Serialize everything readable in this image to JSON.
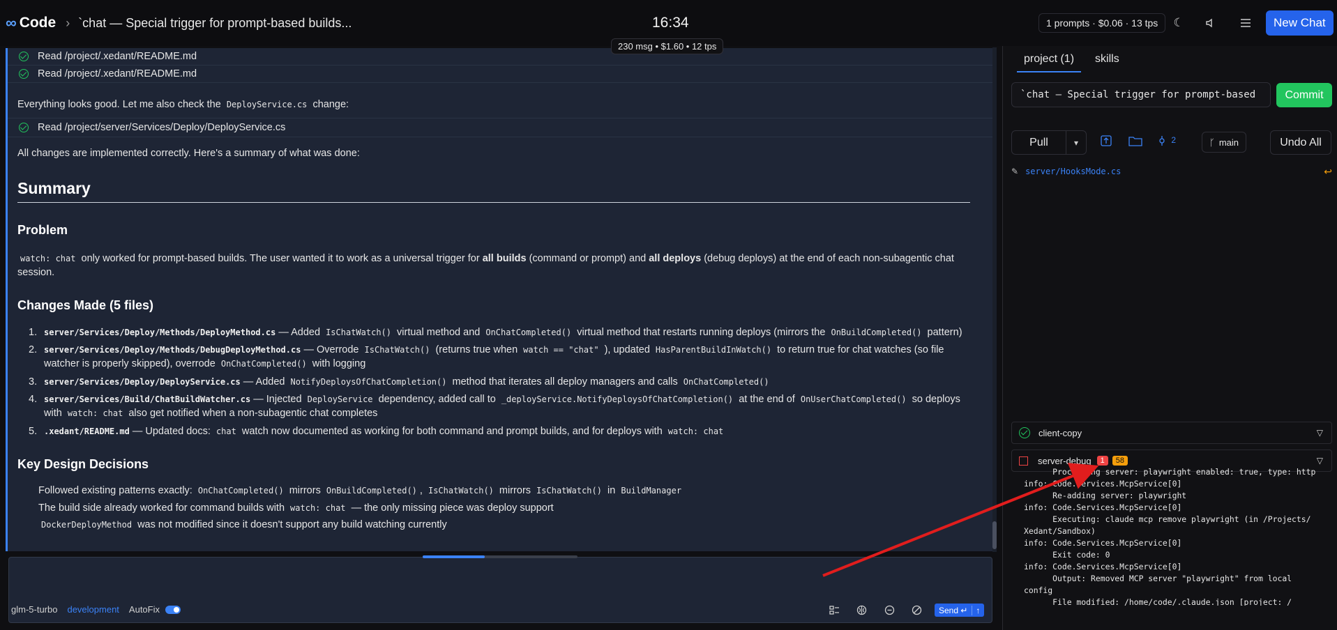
{
  "topbar": {
    "logo_symbol": "∞",
    "app_name": "Code",
    "separator": "›",
    "chat_title": "`chat — Special trigger for prompt-based builds...",
    "clock": "16:34",
    "stats": "1 prompts · $0.06 · 13 tps",
    "msg_stats": "230 msg • $1.60 • 12 tps",
    "new_chat_label": "New Chat"
  },
  "chat": {
    "read1": "Read /project/.xedant/README.md",
    "read2": "Read /project/.xedant/README.md",
    "check_pre": "Everything looks good. Let me also check the",
    "check_code": "DeployService.cs",
    "check_post": "change:",
    "read3": "Read /project/server/Services/Deploy/DeployService.cs",
    "all_changes": "All changes are implemented correctly. Here's a summary of what was done:",
    "summary_heading": "Summary",
    "problem_heading": "Problem",
    "problem_code": "watch: chat",
    "problem_t1": "only worked for prompt-based builds. The user wanted it to work as a universal trigger for",
    "problem_b1": "all builds",
    "problem_t2": "(command or prompt) and",
    "problem_b2": "all deploys",
    "problem_t3": "(debug deploys) at the end of each non-subagentic chat session.",
    "changes_heading": "Changes Made (5 files)",
    "items": [
      {
        "num": "1.",
        "file": "server/Services/Deploy/Methods/DeployMethod.cs",
        "t1": "— Added",
        "c1": "IsChatWatch()",
        "t2": "virtual method and",
        "c2": "OnChatCompleted()",
        "t3": "virtual method that restarts running deploys (mirrors the",
        "c3": "OnBuildCompleted()",
        "t4": "pattern)"
      },
      {
        "num": "2.",
        "file": "server/Services/Deploy/Methods/DebugDeployMethod.cs",
        "t1": "— Overrode",
        "c1": "IsChatWatch()",
        "t2": "(returns true when",
        "c2": "watch == \"chat\"",
        "t3": "), updated",
        "c3": "HasParentBuildInWatch()",
        "t4": "to return true for chat watches (so file watcher is properly skipped), overrode",
        "c4": "OnChatCompleted()",
        "t5": "with logging"
      },
      {
        "num": "3.",
        "file": "server/Services/Deploy/DeployService.cs",
        "t1": "— Added",
        "c1": "NotifyDeploysOfChatCompletion()",
        "t2": "method that iterates all deploy managers and calls",
        "c2": "OnChatCompleted()"
      },
      {
        "num": "4.",
        "file": "server/Services/Build/ChatBuildWatcher.cs",
        "t1": "— Injected",
        "c1": "DeployService",
        "t2": "dependency, added call to",
        "c2": "_deployService.NotifyDeploysOfChatCompletion()",
        "t3": "at the end of",
        "c3": "OnUserChatCompleted()",
        "t4": "so deploys with",
        "c4": "watch: chat",
        "t5": "also get notified when a non-subagentic chat completes"
      },
      {
        "num": "5.",
        "file": ".xedant/README.md",
        "t1": "— Updated docs:",
        "c1": "chat",
        "t2": "watch now documented as working for both command and prompt builds, and for deploys with",
        "c2": "watch: chat"
      }
    ],
    "decisions_heading": "Key Design Decisions",
    "b1_t1": "Followed existing patterns exactly:",
    "b1_c1": "OnChatCompleted()",
    "b1_t2": "mirrors",
    "b1_c2": "OnBuildCompleted()",
    "b1_t3": ",",
    "b1_c3": "IsChatWatch()",
    "b1_t4": "mirrors",
    "b1_c4": "IsChatWatch()",
    "b1_t5": "in",
    "b1_c5": "BuildManager",
    "b2_t1": "The build side already worked for command builds with",
    "b2_c1": "watch: chat",
    "b2_t2": "— the only missing piece was deploy support",
    "b3_c1": "DockerDeployMethod",
    "b3_t1": "was not modified since it doesn't support any build watching currently"
  },
  "input": {
    "progress": 0.4,
    "model": "glm-5-turbo",
    "env": "development",
    "autofix_label": "AutoFix",
    "autofix_on": true,
    "send_label": "Send ↵"
  },
  "panel": {
    "tab_project": "project (1)",
    "tab_skills": "skills",
    "commit_message": "`chat — Special trigger for prompt-based",
    "commit_label": "Commit",
    "pull_label": "Pull",
    "changes_count": "2",
    "branch": "main",
    "undo_label": "Undo All",
    "file": "server/HooksMode.cs",
    "proc_client": "client-copy",
    "proc_server": "server-debug",
    "badge_err": "1",
    "badge_warn": "58",
    "logs": "      Processing server: playwright enabled: true, type: http\ninfo: Code.Services.McpService[0]\n      Re-adding server: playwright\ninfo: Code.Services.McpService[0]\n      Executing: claude mcp remove playwright (in /Projects/\nXedant/Sandbox)\ninfo: Code.Services.McpService[0]\n      Exit code: 0\ninfo: Code.Services.McpService[0]\n      Output: Removed MCP server \"playwright\" from local\nconfig\n      File modified: /home/code/.claude.json [project: /\nProjects/Xedant/Sandbox]"
  },
  "colors": {
    "accent": "#3b82f6",
    "success": "#22c55e",
    "error": "#ef4444",
    "warning": "#f59e0b",
    "annotation": "#e11d1d"
  },
  "icons": [
    "infinity-logo-icon",
    "moon-icon",
    "speaker-icon",
    "menu-icon",
    "check-circle-icon",
    "chevron-down-icon",
    "upload-icon",
    "folder-icon",
    "commit-icon",
    "branch-icon",
    "pencil-icon",
    "revert-icon",
    "layout-icon",
    "brain-icon",
    "minus-circle-icon",
    "no-entry-icon",
    "enter-icon",
    "up-arrow-icon"
  ]
}
